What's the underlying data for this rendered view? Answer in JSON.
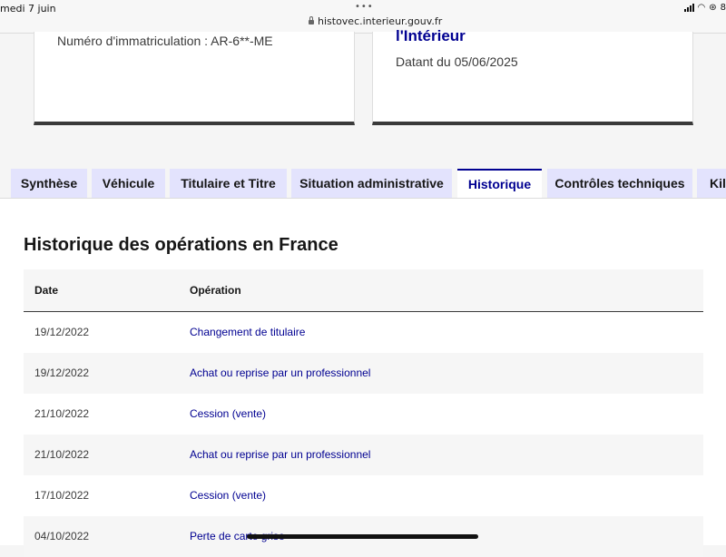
{
  "status_bar": {
    "time": "medi 7 juin",
    "url": "histovec.interieur.gouv.fr",
    "battery_text": "8"
  },
  "cards": {
    "left": {
      "plate_text": "Numéro d'immatriculation : AR-6**-ME"
    },
    "right": {
      "title": "l'Intérieur",
      "dated_text": "Datant du 05/06/2025"
    }
  },
  "tabs": [
    {
      "label": "Synthèse",
      "active": false
    },
    {
      "label": "Véhicule",
      "active": false
    },
    {
      "label": "Titulaire et Titre",
      "active": false
    },
    {
      "label": "Situation administrative",
      "active": false
    },
    {
      "label": "Historique",
      "active": true
    },
    {
      "label": "Contrôles techniques",
      "active": false
    },
    {
      "label": "Kilo",
      "active": false
    }
  ],
  "history": {
    "heading": "Historique des opérations en France",
    "columns": [
      "Date",
      "Opération"
    ],
    "rows": [
      {
        "date": "19/12/2022",
        "operation": "Changement de titulaire"
      },
      {
        "date": "19/12/2022",
        "operation": "Achat ou reprise par un professionnel"
      },
      {
        "date": "21/10/2022",
        "operation": "Cession (vente)"
      },
      {
        "date": "21/10/2022",
        "operation": "Achat ou reprise par un professionnel"
      },
      {
        "date": "17/10/2022",
        "operation": "Cession (vente)"
      },
      {
        "date": "04/10/2022",
        "operation": "Perte de carte grise"
      }
    ]
  },
  "colors": {
    "accent": "#000091",
    "tab_inactive_bg": "#e3e3fd",
    "row_alt_bg": "#f6f6f6"
  }
}
